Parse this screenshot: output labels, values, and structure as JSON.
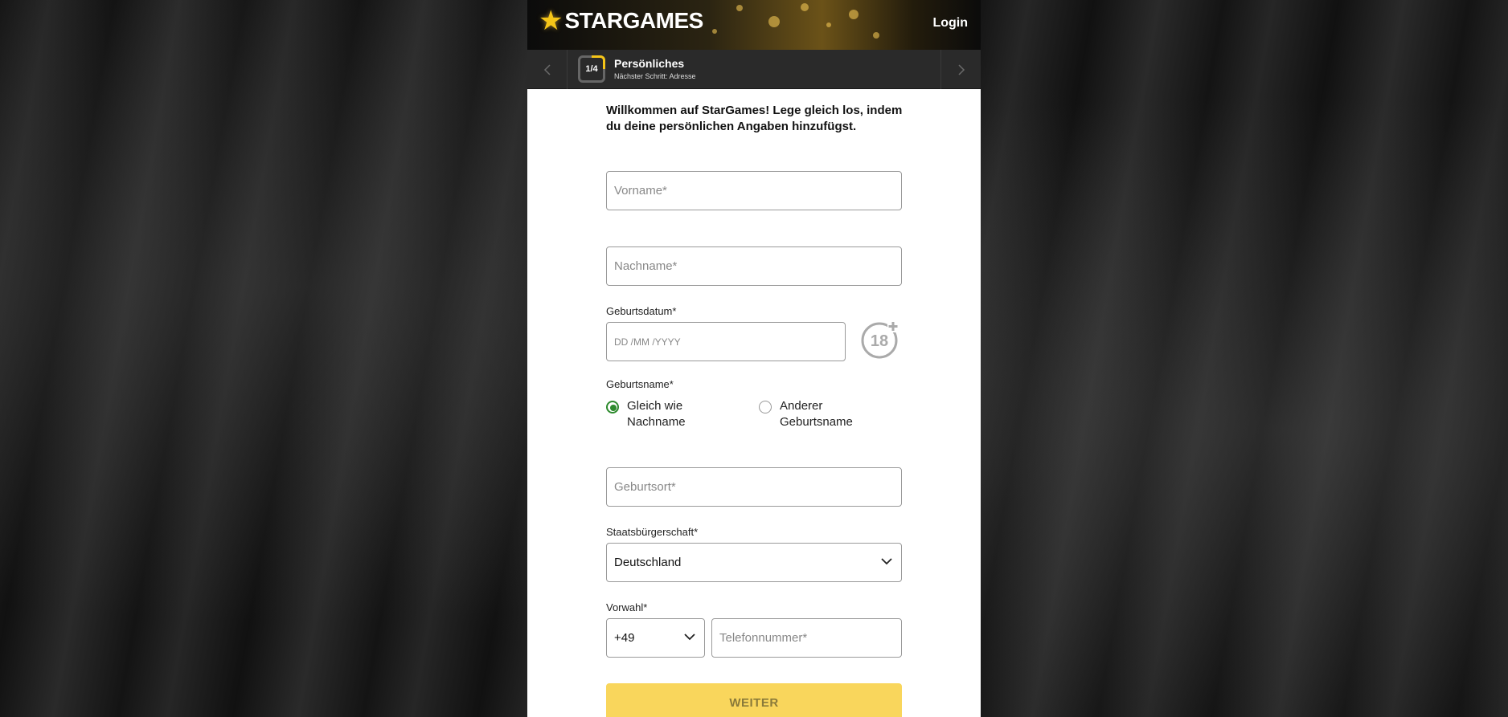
{
  "header": {
    "logo_text": "STARGAMES",
    "login_label": "Login"
  },
  "stepper": {
    "step": "1/4",
    "title": "Persönliches",
    "next_step": "Nächster Schritt: Adresse"
  },
  "intro": "Willkommen auf StarGames! Lege gleich los, indem du deine persönlichen Angaben hinzufügst.",
  "form": {
    "first_name_placeholder": "Vorname*",
    "last_name_placeholder": "Nachname*",
    "birthdate_label": "Geburtsdatum*",
    "birthdate_placeholder": "DD /MM /YYYY",
    "age_badge": "18",
    "birthname_label": "Geburtsname*",
    "birthname_options": [
      {
        "label": "Gleich wie Nachname",
        "selected": true
      },
      {
        "label": "Anderer Geburtsname",
        "selected": false
      }
    ],
    "birthplace_placeholder": "Geburtsort*",
    "citizenship_label": "Staatsbürgerschaft*",
    "citizenship_value": "Deutschland",
    "prefix_label": "Vorwahl*",
    "prefix_value": "+49",
    "phone_placeholder": "Telefonnummer*",
    "submit_label": "WEITER"
  },
  "colors": {
    "accent": "#f5c518",
    "button": "#f9d65c",
    "radio_selected": "#2e8b2e"
  }
}
